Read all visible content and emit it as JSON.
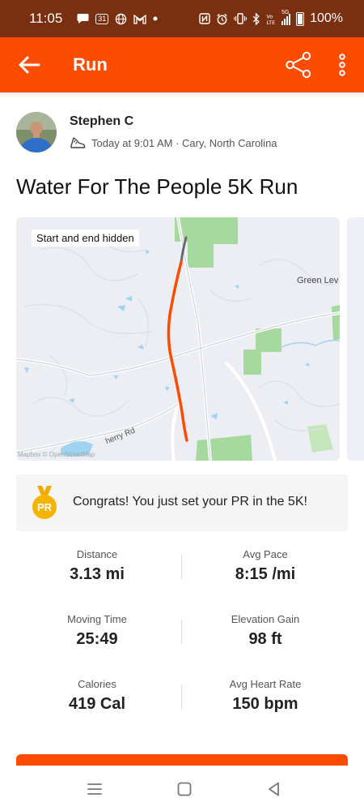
{
  "status_bar": {
    "time": "11:05",
    "calendar_day": "31",
    "battery_pct": "100%",
    "network": "5G",
    "left_icons": [
      "chat-icon",
      "calendar-icon",
      "globe-icon",
      "gmail-icon",
      "dot-icon"
    ],
    "right_icons": [
      "nfc-icon",
      "alarm-icon",
      "vibrate-icon",
      "bluetooth-icon",
      "volte-icon",
      "signal-icon",
      "battery-icon"
    ]
  },
  "app_bar": {
    "title": "Run",
    "color": "#fc4c02"
  },
  "athlete": {
    "name": "Stephen C",
    "meta": "Today at 9:01 AM · Cary, North Carolina"
  },
  "activity": {
    "title": "Water For The People 5K Run"
  },
  "map": {
    "badge": "Start and end hidden",
    "place_label": "Green Lev",
    "road_label": "herry Rd",
    "attribution": "Mapbox © OpenStreetMap",
    "route_color": "#fc4c02"
  },
  "pr": {
    "medal_text": "PR",
    "message": "Congrats! You just set your PR in the 5K!"
  },
  "stats": [
    {
      "label": "Distance",
      "value": "3.13 mi"
    },
    {
      "label": "Avg Pace",
      "value": "8:15 /mi"
    },
    {
      "label": "Moving Time",
      "value": "25:49"
    },
    {
      "label": "Elevation Gain",
      "value": "98 ft"
    },
    {
      "label": "Calories",
      "value": "419 Cal"
    },
    {
      "label": "Avg Heart Rate",
      "value": "150 bpm"
    }
  ]
}
